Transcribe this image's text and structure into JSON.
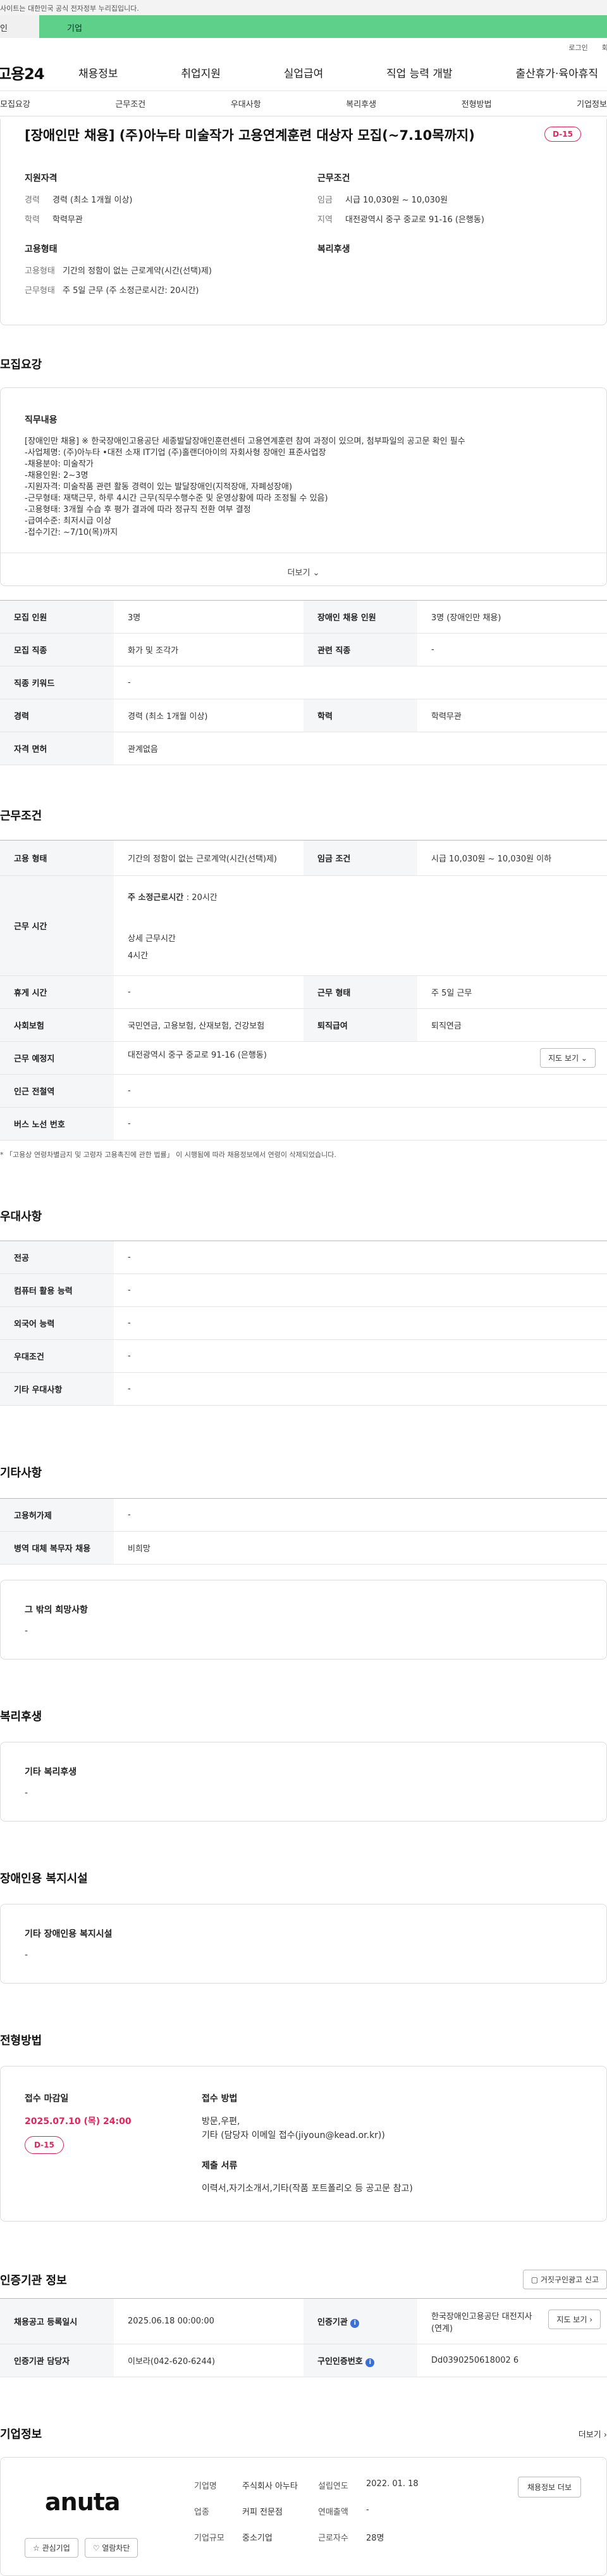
{
  "top": {
    "notice": "사이트는 대한민국 공식 전자정부 누리집입니다.",
    "tab_person": "인",
    "tab_company": "기업",
    "login": "로그인",
    "signup": "회원"
  },
  "gnb": {
    "logo": "고용24",
    "menu": [
      "채용정보",
      "취업지원",
      "실업급여",
      "직업 능력 개발",
      "출산휴가·육아휴직"
    ]
  },
  "subnav": [
    "모집요강",
    "근무조건",
    "우대사항",
    "복리후생",
    "전형방법",
    "기업정보"
  ],
  "summary": {
    "title": "[장애인만 채용] (주)아누타 미술작가 고용연계훈련 대상자 모집(~7.10목까지)",
    "dday": "D-15",
    "qual_title": "지원자격",
    "qual": [
      {
        "k": "경력",
        "v": "경력 (최소 1개월 이상)"
      },
      {
        "k": "학력",
        "v": "학력무관"
      }
    ],
    "emptype_title": "고용형태",
    "emptype": [
      {
        "k": "고용형태",
        "v": "기간의 정함이 없는 근로계약(시간(선택)제)"
      },
      {
        "k": "근무형태",
        "v": "주 5일 근무 (주 소정근로시간: 20시간)"
      }
    ],
    "cond_title": "근무조건",
    "cond": [
      {
        "k": "임금",
        "v": "시급 10,030원 ~ 10,030원"
      },
      {
        "k": "지역",
        "v": "대전광역시 중구 중교로 91-16 (은행동)"
      }
    ],
    "welfare_title": "복리후생"
  },
  "recruit": {
    "section_title": "모집요강",
    "desc_title": "직무내용",
    "desc": "[장애인만 채용] ※ 한국장애인고용공단 세종발달장애인훈련센터 고용연계훈련 참여 과정이 있으며, 첨부파일의 공고문 확인 필수\n-사업체명: (주)아누타 •대전 소재 IT기업 (주)홀랜더아이의 자회사형 장애인 표준사업장\n-채용분야: 미술작가\n-채용인원: 2~3명\n-지원자격: 미술작품 관련 활동 경력이 있는 발달장애인(지적장애, 자폐성장애)\n-근무형태: 재택근무, 하루 4시간 근무(직무수행수준 및 운영상황에 따라 조정될 수 있음)\n-고용형태: 3개월 수습 후 평가 결과에 따라 정규직 전환 여부 결정\n-급여수준: 최저시급 이상\n-접수기간: ~7/10(목)까지",
    "more": "더보기",
    "rows": [
      [
        {
          "k": "모집 인원",
          "v": "3명"
        },
        {
          "k": "장애인 채용 인원",
          "v": "3명 (장애인만 채용)"
        }
      ],
      [
        {
          "k": "모집 직종",
          "v": "화가 및 조각가"
        },
        {
          "k": "관련 직종",
          "v": "-"
        }
      ],
      [
        {
          "k": "직종 키워드",
          "v": "-"
        }
      ],
      [
        {
          "k": "경력",
          "v": "경력 (최소 1개월 이상)"
        },
        {
          "k": "학력",
          "v": "학력무관"
        }
      ],
      [
        {
          "k": "자격 면허",
          "v": "관계없음"
        }
      ]
    ]
  },
  "work": {
    "section_title": "근무조건",
    "emp_type_k": "고용 형태",
    "emp_type_v": "기간의 정함이 없는 근로계약(시간(선택)제)",
    "wage_k": "임금 조건",
    "wage_v": "시급 10,030원 ~ 10,030원 이하",
    "hours_k": "근무 시간",
    "hours_label": "주 소정근로시간 ",
    "hours_value": ": 20시간",
    "detail_label": "상세 근무시간",
    "detail_value": "4시간",
    "break_k": "휴게 시간",
    "break_v": "-",
    "form_k": "근무 형태",
    "form_v": "주 5일 근무",
    "ins_k": "사회보험",
    "ins_v": "국민연금, 고용보험, 산재보험, 건강보험",
    "sev_k": "퇴직급여",
    "sev_v": "퇴직연금",
    "place_k": "근무 예정지",
    "place_v": "대전광역시 중구 중교로 91-16 (은행동)",
    "map_btn": "지도 보기 ⌄",
    "subway_k": "인근 전철역",
    "subway_v": "-",
    "bus_k": "버스 노선 번호",
    "bus_v": "-",
    "footnote": "* 「고용상 연령차별금지 및 고령자 고용촉진에 관한 법률」 이 시행됨에 따라 채용정보에서 연령이 삭제되었습니다."
  },
  "pref": {
    "section_title": "우대사항",
    "rows": [
      {
        "k": "전공",
        "v": "-"
      },
      {
        "k": "컴퓨터 활용 능력",
        "v": "-"
      },
      {
        "k": "외국어 능력",
        "v": "-"
      },
      {
        "k": "우대조건",
        "v": "-"
      },
      {
        "k": "기타 우대사항",
        "v": "-"
      }
    ]
  },
  "etc": {
    "section_title": "기타사항",
    "rows": [
      {
        "k": "고용허가제",
        "v": "-"
      },
      {
        "k": "병역 대체 복무자 채용",
        "v": "비희망"
      }
    ],
    "other_title": "그 밖의 희망사항",
    "other_value": "-"
  },
  "welfare": {
    "section_title": "복리후생",
    "item_title": "기타 복리후생",
    "item_value": "-"
  },
  "disability": {
    "section_title": "장애인용 복지시설",
    "item_title": "기타 장애인용 복지시설",
    "item_value": "-"
  },
  "process": {
    "section_title": "전형방법",
    "deadline_title": "접수 마감일",
    "deadline": "2025.07.10 (목) 24:00",
    "dday": "D-15",
    "method_title": "접수 방법",
    "method_line1": "방문,우편,",
    "method_line2": "기타 (담당자 이메일 접수(jiyoun@kead.or.kr))",
    "docs_title": "제출 서류",
    "docs": "이력서,자기소개서,기타(작품 포트폴리오 등 공고문 참고)"
  },
  "cert": {
    "section_title": "인증기관 정보",
    "report_btn": "거짓구인광고 신고",
    "reg_k": "채용공고 등록일시",
    "reg_v": "2025.06.18 00:00:00",
    "org_k": "인증기관",
    "org_v": "한국장애인고용공단 대전지사(연계)",
    "map_btn": "지도 보기 ›",
    "mgr_k": "인증기관 담당자",
    "mgr_v": "이보라(042-620-6244)",
    "no_k": "구인인증번호",
    "no_v": "Dd0390250618002 6"
  },
  "company": {
    "section_title": "기업정보",
    "more": "더보기 ›",
    "logo": "anuta",
    "fields": [
      {
        "k": "기업명",
        "v": "주식회사 아누타"
      },
      {
        "k": "설립연도",
        "v": "2022. 01. 18"
      },
      {
        "k": "업종",
        "v": "커피 전문점"
      },
      {
        "k": "연매출액",
        "v": "-"
      },
      {
        "k": "기업규모",
        "v": "중소기업"
      },
      {
        "k": "근로자수",
        "v": "28명"
      }
    ],
    "jobs_btn": "채용정보 더보",
    "fav_btn": "☆ 관심기업",
    "block_btn": "♡ 열람차단"
  }
}
